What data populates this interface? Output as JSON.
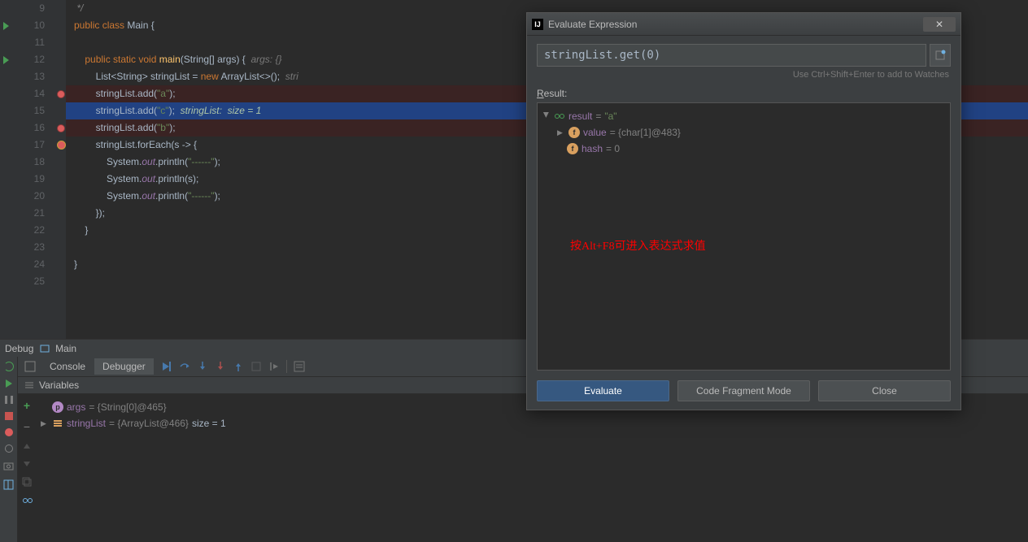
{
  "code": {
    "lines": [
      9,
      10,
      11,
      12,
      13,
      14,
      15,
      16,
      17,
      18,
      19,
      20,
      21,
      22,
      23,
      24,
      25
    ],
    "l9": "*/",
    "l10_kw1": "public class ",
    "l10_cls": "Main",
    "l10_r": " {",
    "l12_kw": "public static void ",
    "l12_fn": "main",
    "l12_sig": "(String[] args) {",
    "l12_hint": "  args: {}",
    "l13_a": "List<String> stringList = ",
    "l13_kw": "new ",
    "l13_b": "ArrayList<>();",
    "l13_hint": "  stri",
    "l14_a": "stringList.add(",
    "l14_s": "\"a\"",
    "l14_b": ");",
    "l15_a": "stringList.add(",
    "l15_s": "\"c\"",
    "l15_b": ");",
    "l15_hint": "  stringList:  size = 1",
    "l16_a": "stringList.add(",
    "l16_s": "\"b\"",
    "l16_b": ");",
    "l17_a": "stringList.forEach(s -> {",
    "l18_a": "System.",
    "l18_f": "out",
    "l18_b": ".println(",
    "l18_s": "\"------\"",
    "l18_c": ");",
    "l19_a": "System.",
    "l19_f": "out",
    "l19_b": ".println(s);",
    "l20_a": "System.",
    "l20_f": "out",
    "l20_b": ".println(",
    "l20_s": "\"------\"",
    "l20_c": ");",
    "l21": "});",
    "l22": "}",
    "l24": "}"
  },
  "breadcrumb": {
    "label": "Debug",
    "target": "Main"
  },
  "debug": {
    "tab_console": "Console",
    "tab_debugger": "Debugger",
    "vars_title": "Variables",
    "var1_name": "args",
    "var1_val": " = {String[0]@465}",
    "var2_name": "stringList",
    "var2_val": " = {ArrayList@466} ",
    "var2_size": " size = 1"
  },
  "dialog": {
    "title": "Evaluate Expression",
    "expression": "stringList.get(0)",
    "hint": "Use Ctrl+Shift+Enter to add to Watches",
    "result_label_u": "R",
    "result_label": "esult:",
    "r1_name": "result",
    "r1_eq": " = ",
    "r1_val": "\"a\"",
    "r2_name": "value",
    "r2_val": " = {char[1]@483}",
    "r3_name": "hash",
    "r3_val": " = 0",
    "annotation": "按Alt+F8可进入表达式求值",
    "btn_eval": "Evaluate",
    "btn_frag": "Code Fragment Mode",
    "btn_close": "Close"
  }
}
